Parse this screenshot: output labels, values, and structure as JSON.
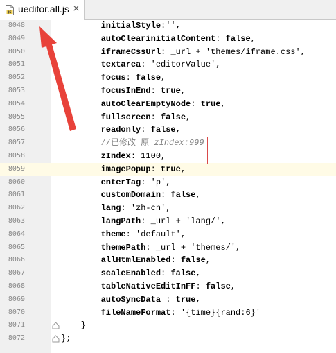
{
  "tab": {
    "file_name": "ueditor.all.js",
    "close_glyph": "×"
  },
  "colors": {
    "annotation_red": "#e8423a",
    "current_line_bg": "#fffbe6",
    "gutter_bg": "#f0f0f0"
  },
  "editor": {
    "current_line": "8059",
    "lines": [
      {
        "num": "8048",
        "key": "initialStyle",
        "sep": ":",
        "value": "''",
        "comma": ","
      },
      {
        "num": "8049",
        "key": "autoClearinitialContent",
        "sep": ": ",
        "value": "false",
        "comma": ","
      },
      {
        "num": "8050",
        "key": "iframeCssUrl",
        "sep": ": ",
        "value": "_url + 'themes/iframe.css'",
        "comma": ","
      },
      {
        "num": "8051",
        "key": "textarea",
        "sep": ": ",
        "value": "'editorValue'",
        "comma": ","
      },
      {
        "num": "8052",
        "key": "focus",
        "sep": ": ",
        "value": "false",
        "comma": ","
      },
      {
        "num": "8053",
        "key": "focusInEnd",
        "sep": ": ",
        "value": "true",
        "comma": ","
      },
      {
        "num": "8054",
        "key": "autoClearEmptyNode",
        "sep": ": ",
        "value": "true",
        "comma": ","
      },
      {
        "num": "8055",
        "key": "fullscreen",
        "sep": ": ",
        "value": "false",
        "comma": ","
      },
      {
        "num": "8056",
        "key": "readonly",
        "sep": ": ",
        "value": "false",
        "comma": ","
      },
      {
        "num": "8057",
        "comment_cn": "//已修改 原",
        "comment_code": "zIndex:999"
      },
      {
        "num": "8058",
        "key": "zIndex",
        "sep": ": ",
        "value": "1100",
        "comma": ","
      },
      {
        "num": "8059",
        "key": "imagePopup",
        "sep": ": ",
        "value": "true",
        "comma": ","
      },
      {
        "num": "8060",
        "key": "enterTag",
        "sep": ": ",
        "value": "'p'",
        "comma": ","
      },
      {
        "num": "8061",
        "key": "customDomain",
        "sep": ": ",
        "value": "false",
        "comma": ","
      },
      {
        "num": "8062",
        "key": "lang",
        "sep": ": ",
        "value": "'zh-cn'",
        "comma": ","
      },
      {
        "num": "8063",
        "key": "langPath",
        "sep": ": ",
        "value": "_url + 'lang/'",
        "comma": ","
      },
      {
        "num": "8064",
        "key": "theme",
        "sep": ": ",
        "value": "'default'",
        "comma": ","
      },
      {
        "num": "8065",
        "key": "themePath",
        "sep": ": ",
        "value": "_url + 'themes/'",
        "comma": ","
      },
      {
        "num": "8066",
        "key": "allHtmlEnabled",
        "sep": ": ",
        "value": "false",
        "comma": ","
      },
      {
        "num": "8067",
        "key": "scaleEnabled",
        "sep": ": ",
        "value": "false",
        "comma": ","
      },
      {
        "num": "8068",
        "key": "tableNativeEditInFF",
        "sep": ": ",
        "value": "false",
        "comma": ","
      },
      {
        "num": "8069",
        "key": "autoSyncData",
        "sep": " : ",
        "value": "true",
        "comma": ","
      },
      {
        "num": "8070",
        "key": "fileNameFormat",
        "sep": ": ",
        "value": "'{time}{rand:6}'",
        "comma": ""
      },
      {
        "num": "8071",
        "plain": "    }"
      },
      {
        "num": "8072",
        "plain": "};"
      }
    ]
  }
}
